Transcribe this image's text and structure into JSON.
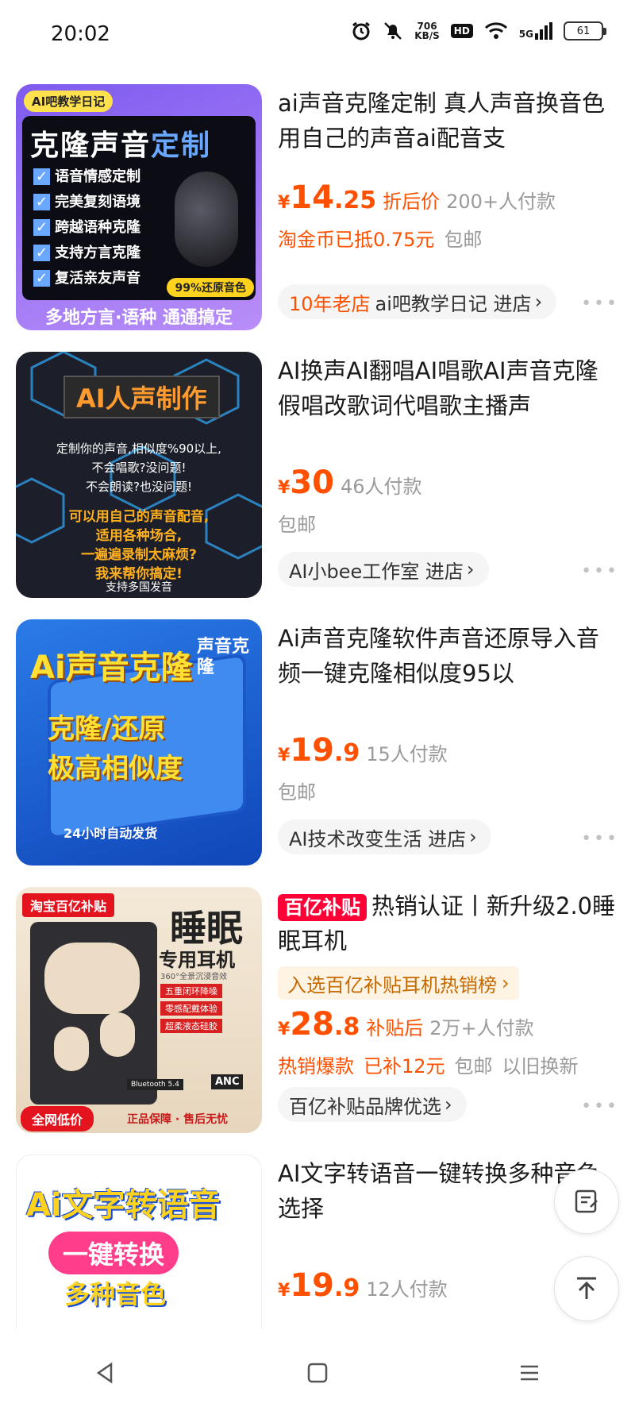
{
  "status_bar": {
    "time": "20:02",
    "net_speed_value": "706",
    "net_speed_unit": "KB/S",
    "hd_label": "HD",
    "signal_label": "5G",
    "battery": "61"
  },
  "products": [
    {
      "title": "ai声音克隆定制 真人声音换音色 用自己的声音ai配音支",
      "price_yen": "¥",
      "price_int": "14",
      "price_dec": ".25",
      "price_label": "折后价",
      "paid": "200+人付款",
      "extra": [
        "淘金币已抵0.75元",
        "包邮"
      ],
      "store_badge": "10年老店",
      "store": "ai吧教学日记 进店",
      "thumb": {
        "top_tag": "AI吧教学日记",
        "headline": "克隆声音",
        "headline_accent": "定制",
        "bullets": [
          "语音情感定制",
          "完美复刻语境",
          "跨越语种克隆",
          "支持方言克隆",
          "复活亲友声音"
        ],
        "stamp": "99%还原音色",
        "footer": "多地方言·语种 通通搞定"
      }
    },
    {
      "title": "AI换声AI翻唱AI唱歌AI声音克隆假唱改歌词代唱歌主播声",
      "price_yen": "¥",
      "price_int": "30",
      "price_dec": "",
      "price_label": "",
      "paid": "46人付款",
      "extra": [
        "包邮"
      ],
      "store_badge": "",
      "store": "AI小bee工作室 进店",
      "thumb": {
        "headline": "AI人声制作",
        "line1": "定制你的声音,相似度%90以上,",
        "line2": "不会唱歌?没问题!",
        "line3": "不会朗读?也没问题!",
        "orange1": "可以用自己的声音配音,",
        "orange2": "适用各种场合,",
        "orange3": "一遍遍录制太麻烦?",
        "orange4": "我来帮你搞定!",
        "footer": "支持多国发音"
      }
    },
    {
      "title": "Ai声音克隆软件声音还原导入音频一键克隆相似度95以",
      "price_yen": "¥",
      "price_int": "19",
      "price_dec": ".9",
      "price_label": "",
      "paid": "15人付款",
      "extra": [
        "包邮"
      ],
      "store_badge": "",
      "store": "AI技术改变生活 进店",
      "thumb": {
        "headline": "Ai声音克隆",
        "sub1": "克隆/还原",
        "sub2": "极高相似度",
        "footer": "24小时自动发货",
        "side": "声音克隆"
      }
    },
    {
      "title_badge": "百亿补贴",
      "title": "热销认证丨新升级2.0睡眠耳机",
      "rank": "入选百亿补贴耳机热销榜",
      "price_yen": "¥",
      "price_int": "28",
      "price_dec": ".8",
      "price_label": "补贴后",
      "paid": "2万+人付款",
      "extra": [
        "热销爆款",
        "已补12元",
        "包邮",
        "以旧换新"
      ],
      "store_badge": "",
      "store": "百亿补贴品牌优选",
      "thumb": {
        "tag": "淘宝百亿补贴",
        "headline": "睡眠",
        "sub": "专用耳机",
        "audio": "360°全景沉浸音效",
        "f1": "五重闭环降噪",
        "f2": "零感配戴体验",
        "f3": "超柔液态硅胶",
        "anc": "ANC",
        "bt": "Bluetooth 5.4",
        "low": "全网低价",
        "guarantee": "正品保障 · 售后无忧"
      }
    },
    {
      "title": "AI文字转语音一键转换多种音色选择",
      "price_yen": "¥",
      "price_int": "19",
      "price_dec": ".9",
      "price_label": "",
      "paid": "12人付款",
      "thumb": {
        "headline": "Ai文字转语音",
        "sub1": "一键转换",
        "sub2": "多种音色"
      }
    }
  ],
  "fab": {
    "edit": "edit-note",
    "top": "back-to-top"
  }
}
